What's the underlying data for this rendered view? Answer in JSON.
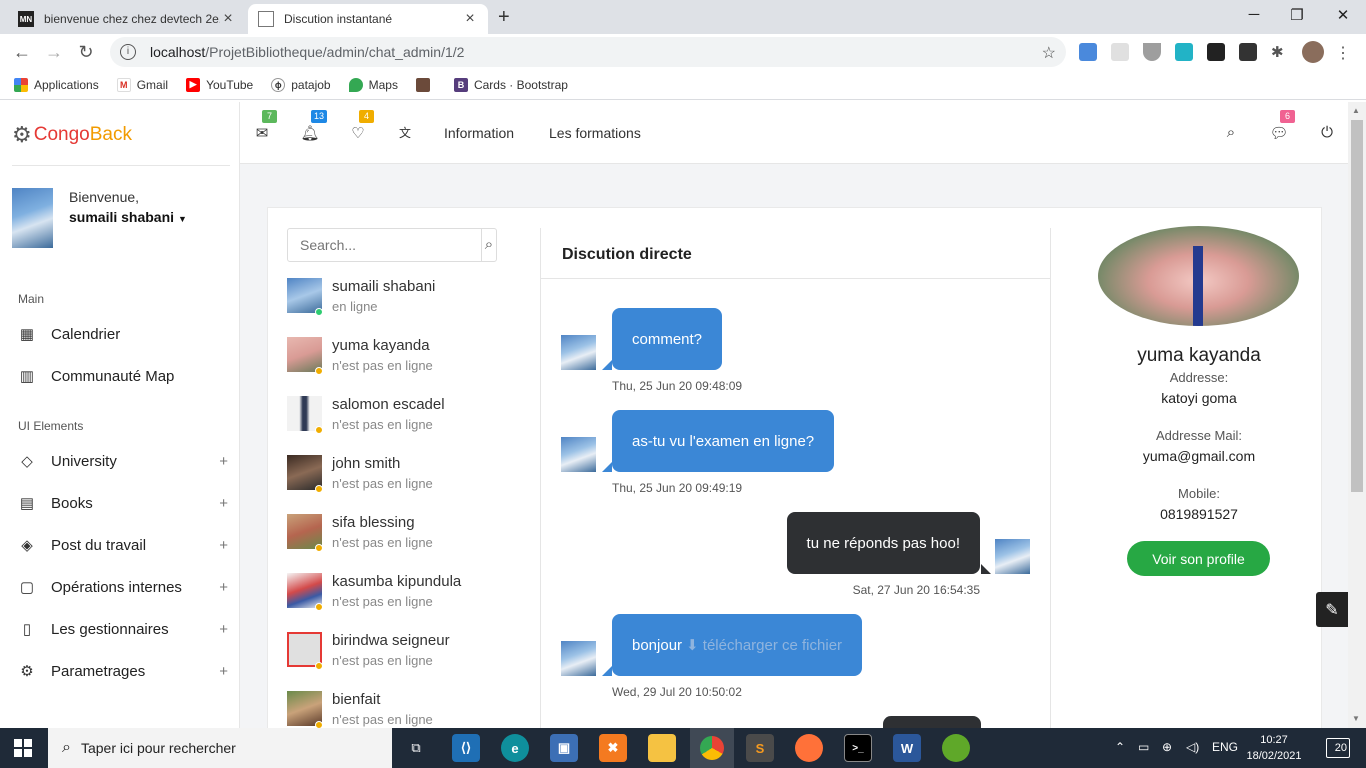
{
  "browser": {
    "tabs": [
      {
        "title": "bienvenue chez chez devtech 2e...",
        "favicon": "MN"
      },
      {
        "title": "Discution instantané",
        "favicon": "doc"
      }
    ],
    "url_host": "localhost",
    "url_path": "/ProjetBibliotheque/admin/chat_admin/1/2",
    "bookmarks": [
      "Applications",
      "Gmail",
      "YouTube",
      "patajob",
      "Maps",
      "",
      "Cards · Bootstrap"
    ]
  },
  "brand": {
    "part1": "Congo",
    "part2": "Back"
  },
  "user": {
    "greeting": "Bienvenue,",
    "name": "sumaili shabani"
  },
  "sidebar": {
    "section_main": "Main",
    "main_items": [
      {
        "label": "Calendrier",
        "icon": "calendar-icon"
      },
      {
        "label": "Communauté Map",
        "icon": "map-icon"
      }
    ],
    "section_ui": "UI Elements",
    "ui_items": [
      {
        "label": "University",
        "icon": "tag-icon"
      },
      {
        "label": "Books",
        "icon": "book-icon"
      },
      {
        "label": "Post du travail",
        "icon": "diamond-icon"
      },
      {
        "label": "Opérations internes",
        "icon": "clipboard-icon"
      },
      {
        "label": "Les gestionnaires",
        "icon": "tablet-icon"
      },
      {
        "label": "Parametrages",
        "icon": "gear-icon"
      }
    ],
    "plus": "+"
  },
  "topbar": {
    "badges": {
      "mail": "7",
      "bell": "13",
      "heart": "4",
      "chat": "6"
    },
    "links": [
      "Information",
      "Les formations"
    ]
  },
  "search": {
    "placeholder": "Search..."
  },
  "contacts": [
    {
      "name": "sumaili shabani",
      "status": "en ligne",
      "online": true
    },
    {
      "name": "yuma kayanda",
      "status": "n'est pas en ligne",
      "online": false
    },
    {
      "name": "salomon escadel",
      "status": "n'est pas en ligne",
      "online": false
    },
    {
      "name": "john smith",
      "status": "n'est pas en ligne",
      "online": false
    },
    {
      "name": "sifa blessing",
      "status": "n'est pas en ligne",
      "online": false
    },
    {
      "name": "kasumba kipundula",
      "status": "n'est pas en ligne",
      "online": false
    },
    {
      "name": "birindwa seigneur",
      "status": "n'est pas en ligne",
      "online": false
    },
    {
      "name": "bienfait",
      "status": "n'est pas en ligne",
      "online": false
    }
  ],
  "chat": {
    "title": "Discution directe",
    "messages": [
      {
        "text": "comment?",
        "time": "Thu, 25 Jun 20 09:48:09",
        "direction": "in"
      },
      {
        "text": "as-tu vu l'examen en ligne?",
        "time": "Thu, 25 Jun 20 09:49:19",
        "direction": "in"
      },
      {
        "text": "tu ne réponds pas hoo!",
        "time": "Sat, 27 Jun 20 16:54:35",
        "direction": "out"
      },
      {
        "text": "bonjour",
        "attachment": "télécharger ce fichier",
        "time": "Wed, 29 Jul 20 10:50:02",
        "direction": "in"
      }
    ]
  },
  "profile": {
    "name": "yuma kayanda",
    "address_label": "Addresse:",
    "address": "katoyi goma",
    "email_label": "Addresse Mail:",
    "email": "yuma@gmail.com",
    "mobile_label": "Mobile:",
    "mobile": "0819891527",
    "button": "Voir son profile"
  },
  "taskbar": {
    "search_placeholder": "Taper ici pour rechercher",
    "lang": "ENG",
    "time": "10:27",
    "date": "18/02/2021",
    "notifications": "20"
  },
  "colors": {
    "brand_red": "#e53935",
    "brand_orange": "#f29b00",
    "incoming_bubble": "#3b87d6",
    "outgoing_bubble": "#2e3033",
    "profile_button": "#27a844",
    "badge_green": "#5cb85c",
    "badge_blue": "#1e88e5",
    "badge_yellow": "#f0ad00",
    "badge_pink": "#f06292"
  }
}
